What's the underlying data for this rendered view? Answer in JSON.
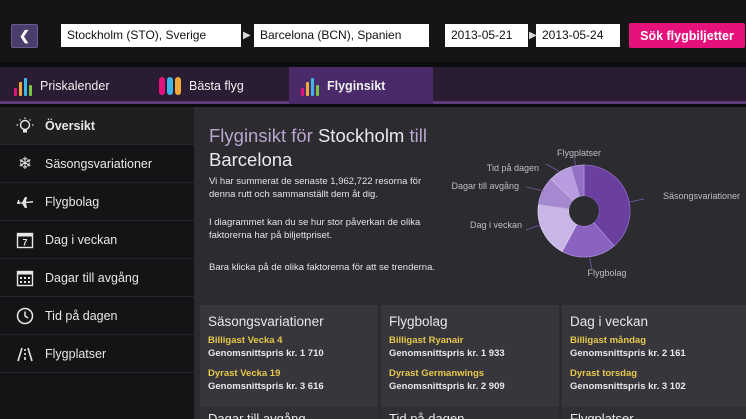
{
  "search": {
    "from": "Stockholm (STO), Sverige",
    "to": "Barcelona (BCN), Spanien",
    "depart": "2013-05-21",
    "return": "2013-05-24",
    "arrow": "▶",
    "back_icon": "chevron-left-icon",
    "submit_label": "Sök flygbiljetter"
  },
  "tabs": [
    {
      "label": "Priskalender"
    },
    {
      "label": "Bästa flyg"
    },
    {
      "label": "Flyginsikt"
    }
  ],
  "sidebar": {
    "items": [
      {
        "label": "Översikt",
        "icon": "lightbulb-icon"
      },
      {
        "label": "Säsongsvariationer",
        "icon": "snowflake-icon"
      },
      {
        "label": "Flygbolag",
        "icon": "airplane-icon"
      },
      {
        "label": "Dag i veckan",
        "icon": "calendar-day-icon"
      },
      {
        "label": "Dagar till avgång",
        "icon": "calendar-grid-icon"
      },
      {
        "label": "Tid på dagen",
        "icon": "clock-icon"
      },
      {
        "label": "Flygplatser",
        "icon": "runway-icon"
      }
    ]
  },
  "main": {
    "title_prefix": "Flyginsikt för",
    "title_from": "Stockholm",
    "title_mid": "till",
    "title_to": "Barcelona",
    "para1": "Vi har summerat de senaste 1,962,722 resorna för denna rutt och sammanställt dem åt dig.",
    "para2": "I diagrammet kan du se hur stor påverkan de olika faktorerna har på biljettpriset.",
    "para3": "Bara klicka på de olika faktorerna för att se trenderna."
  },
  "chart_labels": {
    "flygplatser": "Flygplatser",
    "tid": "Tid på dagen",
    "dagar": "Dagar till avgång",
    "dag": "Dag i veckan",
    "flygbolag": "Flygbolag",
    "sasong": "Säsongsvariationer"
  },
  "colors": {
    "accent": "#e5127e",
    "tab_active": "#4b2a6a",
    "highlight": "#e6c84a"
  },
  "cards": [
    {
      "title": "Säsongsvariationer",
      "cheap_label": "Billigast",
      "cheap_value": "Vecka 4",
      "avg1_label": "Genomsnittspris",
      "avg1_value": "kr. 1 710",
      "exp_label": "Dyrast",
      "exp_value": "Vecka 19",
      "avg2_label": "Genomsnittspris",
      "avg2_value": "kr. 3 616"
    },
    {
      "title": "Flygbolag",
      "cheap_label": "Billigast",
      "cheap_value": "Ryanair",
      "avg1_label": "Genomsnittspris",
      "avg1_value": "kr. 1 933",
      "exp_label": "Dyrast",
      "exp_value": "Germanwings",
      "avg2_label": "Genomsnittspris",
      "avg2_value": "kr. 2 909"
    },
    {
      "title": "Dag i veckan",
      "cheap_label": "Billigast",
      "cheap_value": "måndag",
      "avg1_label": "Genomsnittspris",
      "avg1_value": "kr. 2 161",
      "exp_label": "Dyrast",
      "exp_value": "torsdag",
      "avg2_label": "Genomsnittspris",
      "avg2_value": "kr. 3 102"
    }
  ],
  "cards_row2": [
    {
      "title": "Dagar till avgång"
    },
    {
      "title": "Tid på dagen"
    },
    {
      "title": "Flygplatser"
    }
  ]
}
